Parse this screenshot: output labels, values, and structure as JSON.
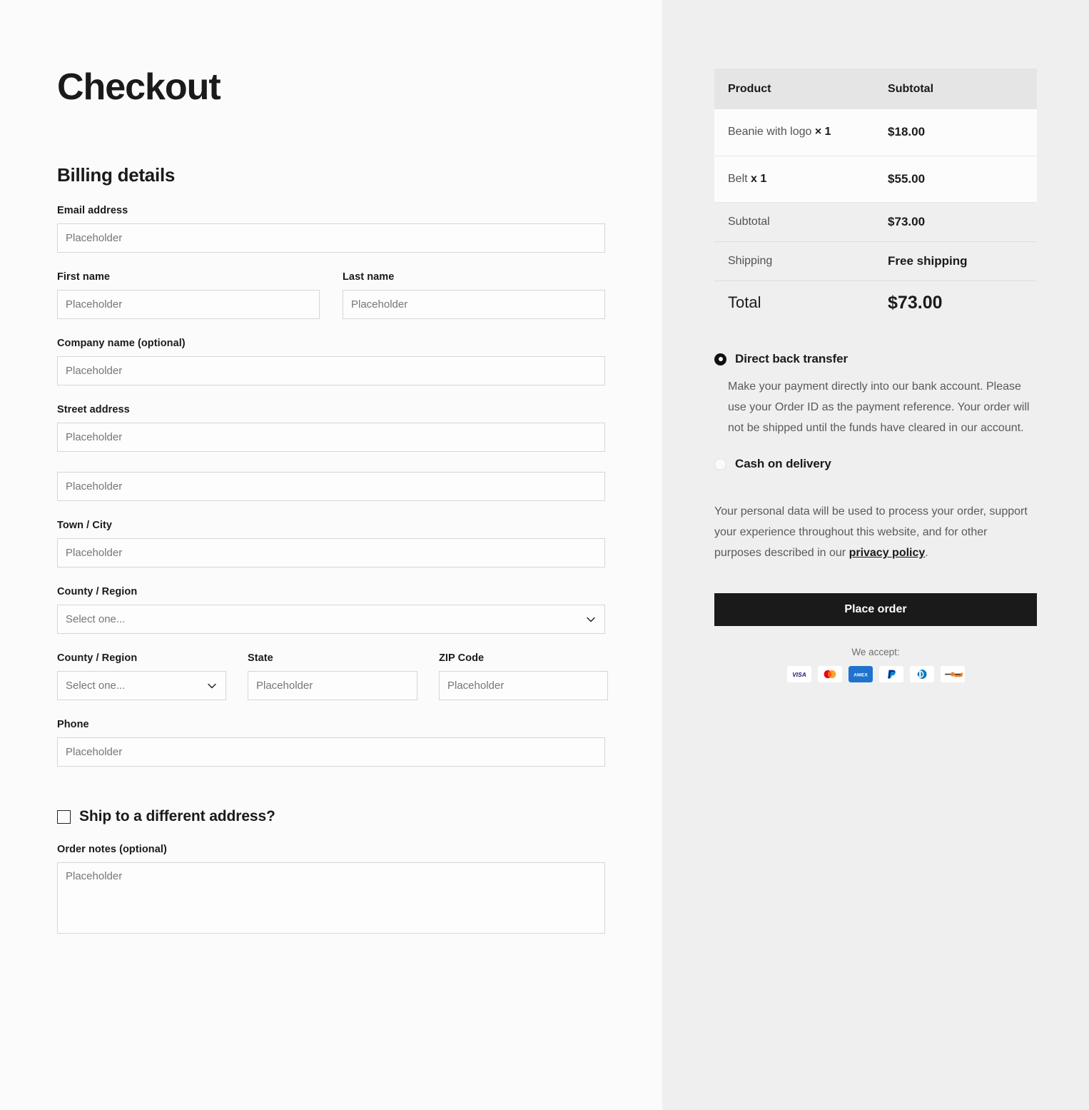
{
  "page": {
    "title": "Checkout"
  },
  "billing": {
    "section_title": "Billing details",
    "email": {
      "label": "Email address",
      "placeholder": "Placeholder",
      "value": ""
    },
    "first_name": {
      "label": "First name",
      "placeholder": "Placeholder",
      "value": ""
    },
    "last_name": {
      "label": "Last name",
      "placeholder": "Placeholder",
      "value": ""
    },
    "company": {
      "label": "Company name (optional)",
      "placeholder": "Placeholder",
      "value": ""
    },
    "street": {
      "label": "Street address",
      "placeholder": "Placeholder",
      "value": "",
      "placeholder2": "Placeholder",
      "value2": ""
    },
    "city": {
      "label": "Town / City",
      "placeholder": "Placeholder",
      "value": ""
    },
    "county": {
      "label": "County / Region",
      "selected": "Select one..."
    },
    "county2": {
      "label": "County / Region",
      "selected": "Select one..."
    },
    "state": {
      "label": "State",
      "placeholder": "Placeholder",
      "value": ""
    },
    "zip": {
      "label": "ZIP Code",
      "placeholder": "Placeholder",
      "value": ""
    },
    "phone": {
      "label": "Phone",
      "placeholder": "Placeholder",
      "value": ""
    },
    "ship_different": {
      "label": "Ship to a different address?",
      "checked": false
    },
    "order_notes": {
      "label": "Order notes (optional)",
      "placeholder": "Placeholder",
      "value": ""
    }
  },
  "summary": {
    "headers": {
      "product": "Product",
      "subtotal": "Subtotal"
    },
    "items": [
      {
        "name": "Beanie with logo",
        "qty": "× 1",
        "amount": "$18.00"
      },
      {
        "name": "Belt",
        "qty": "x 1",
        "amount": "$55.00"
      }
    ],
    "subtotal": {
      "label": "Subtotal",
      "amount": "$73.00"
    },
    "shipping": {
      "label": "Shipping",
      "amount": "Free shipping"
    },
    "total": {
      "label": "Total",
      "amount": "$73.00"
    }
  },
  "payment": {
    "methods": [
      {
        "label": "Direct back transfer",
        "selected": true,
        "description": "Make your payment directly into our bank account. Please use your Order ID as the payment reference. Your order will not be shipped until the funds have cleared in our account."
      },
      {
        "label": "Cash on delivery",
        "selected": false,
        "description": ""
      }
    ],
    "privacy_prefix": "Your personal data will be used to process your order, support your experience throughout this website, and for other purposes described in our ",
    "privacy_link": "privacy policy",
    "privacy_suffix": ".",
    "place_order_label": "Place order",
    "we_accept_label": "We accept:",
    "cards": [
      {
        "name": "visa-card-icon",
        "label": "VISA"
      },
      {
        "name": "mastercard-card-icon",
        "label": "Mastercard"
      },
      {
        "name": "amex-card-icon",
        "label": "AMEX"
      },
      {
        "name": "paypal-card-icon",
        "label": "PayPal"
      },
      {
        "name": "diners-club-card-icon",
        "label": "Diners Club"
      },
      {
        "name": "discover-card-icon",
        "label": "Discover"
      }
    ]
  },
  "colors": {
    "page_bg": "#fbfbfb",
    "panel_bg": "#efefef",
    "accent": "#1a1a1a",
    "table_header_bg": "#e5e5e5",
    "row_bg": "#fcfcfc",
    "border": "#d6d6d6"
  }
}
